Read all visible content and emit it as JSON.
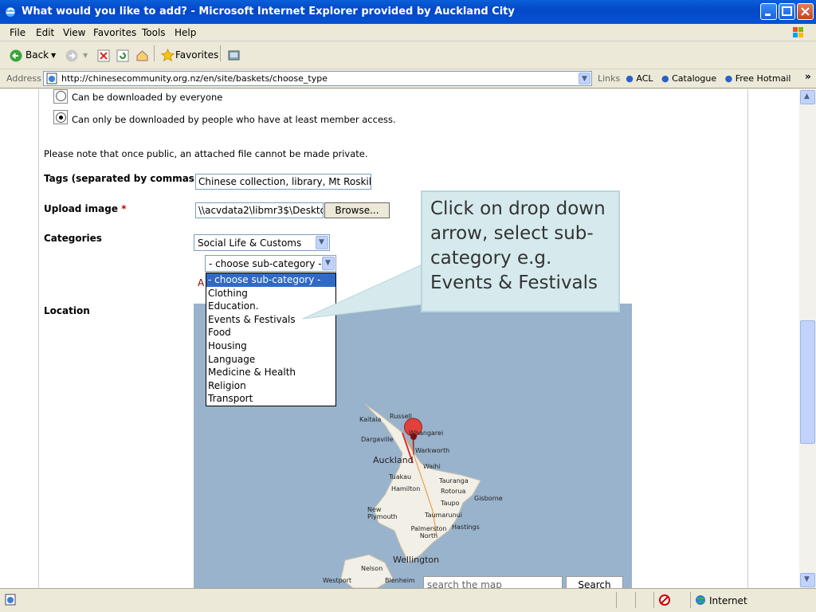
{
  "window": {
    "title": "What would you like to add? - Microsoft Internet Explorer provided by Auckland City"
  },
  "menu": [
    "File",
    "Edit",
    "View",
    "Favorites",
    "Tools",
    "Help"
  ],
  "toolbar": {
    "back": "Back",
    "favorites": "Favorites"
  },
  "address": {
    "label": "Address",
    "url": "http://chinesecommunity.org.nz/en/site/baskets/choose_type",
    "links_label": "Links",
    "links": [
      "ACL",
      "Catalogue",
      "Free Hotmail"
    ],
    "more": "»"
  },
  "form": {
    "radio_everyone": "Can be downloaded by everyone",
    "radio_members": "Can only be downloaded by people who have at least member access.",
    "note": "Please note that once public, an attached file cannot be made private.",
    "tags_label": "Tags (separated by commas)",
    "tags_value": "Chinese collection, library, Mt Roskill",
    "upload_label": "Upload image",
    "upload_required": "*",
    "upload_value": "\\\\acvdata2\\libmr3$\\Deskto",
    "browse": "Browse...",
    "categories_label": "Categories",
    "category_value": "Social Life & Customs",
    "subcategory_value": "- choose sub-category -",
    "partial_link": "A",
    "location_label": "Location"
  },
  "dropdown_options": [
    "- choose sub-category -",
    "Clothing",
    "Education.",
    "Events & Festivals",
    "Food",
    "Housing",
    "Language",
    "Medicine & Health",
    "Religion",
    "Transport"
  ],
  "callout": {
    "text": "Click on drop down arrow, select sub-category e.g. Events & Festivals"
  },
  "map": {
    "cities": [
      "Kaitaia",
      "Russell",
      "Whangarei",
      "Dargaville",
      "Warkworth",
      "Auckland",
      "Waihi",
      "Tuakau",
      "Tauranga",
      "Hamilton",
      "Rotorua",
      "Gisborne",
      "Taupo",
      "New Plymouth",
      "Taumarunui",
      "Palmerston North",
      "Hastings",
      "Wellington",
      "Nelson",
      "Westport",
      "Blenheim"
    ],
    "search_placeholder": "search the map",
    "search_button": "Search",
    "water_color": "#99b3cc",
    "land_color": "#f2efe6",
    "pin_color": "#e0413a"
  },
  "status": {
    "zone": "Internet"
  }
}
